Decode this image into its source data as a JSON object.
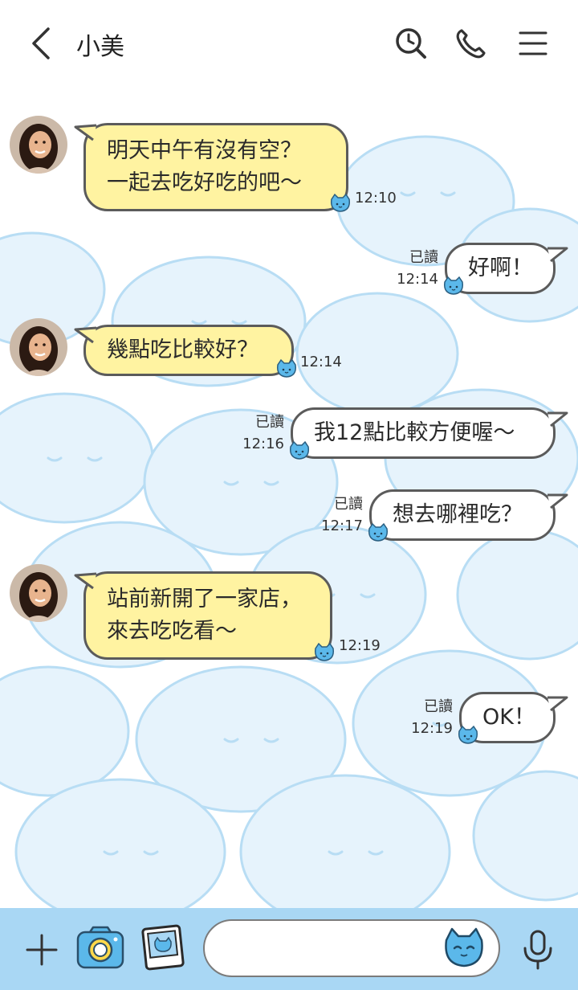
{
  "header": {
    "title": "小美",
    "icons": [
      "back-arrow-icon",
      "search-time-icon",
      "phone-icon",
      "menu-icon"
    ]
  },
  "messages": [
    {
      "side": "incoming",
      "lines": [
        "明天中午有沒有空？",
        "一起去吃好吃的吧〜"
      ],
      "time": "12:10"
    },
    {
      "side": "outgoing",
      "lines": [
        "好啊！"
      ],
      "read": "已讀",
      "time": "12:14"
    },
    {
      "side": "incoming",
      "lines": [
        "幾點吃比較好？"
      ],
      "time": "12:14"
    },
    {
      "side": "outgoing",
      "lines": [
        "我12點比較方便喔〜"
      ],
      "read": "已讀",
      "time": "12:16"
    },
    {
      "side": "outgoing",
      "lines": [
        "想去哪裡吃？"
      ],
      "read": "已讀",
      "time": "12:17"
    },
    {
      "side": "incoming",
      "lines": [
        "站前新開了一家店，",
        "來去吃吃看〜"
      ],
      "time": "12:19"
    },
    {
      "side": "outgoing",
      "lines": [
        "OK！"
      ],
      "read": "已讀",
      "time": "12:19"
    }
  ],
  "composer": {
    "placeholder": "",
    "icons": [
      "plus-icon",
      "camera-icon",
      "photo-icon",
      "sticker-cat-icon",
      "microphone-icon"
    ]
  },
  "colors": {
    "incoming_bubble": "#fff3a1",
    "outgoing_bubble": "#ffffff",
    "bubble_border": "#5b5b5b",
    "bottom_bar": "#a9d7f4",
    "pattern": "#cfe8f8",
    "cat_blue": "#5bb8ea"
  }
}
